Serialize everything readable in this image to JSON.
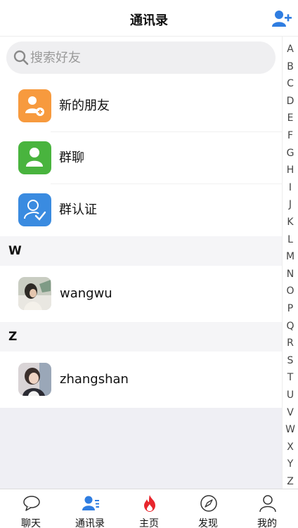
{
  "header": {
    "title": "通讯录",
    "add_icon": "add-friend-icon"
  },
  "search": {
    "placeholder": "搜索好友",
    "icon": "search-icon"
  },
  "menu": [
    {
      "label": "新的朋友",
      "icon": "new-friend-icon",
      "color": "#f79a3e"
    },
    {
      "label": "群聊",
      "icon": "group-chat-icon",
      "color": "#49b43e"
    },
    {
      "label": "群认证",
      "icon": "group-verify-icon",
      "color": "#3a8be0"
    }
  ],
  "sections": [
    {
      "letter": "W",
      "contacts": [
        {
          "name": "wangwu",
          "avatar": "avatar-photo"
        }
      ]
    },
    {
      "letter": "Z",
      "contacts": [
        {
          "name": "zhangshan",
          "avatar": "avatar-photo"
        }
      ]
    }
  ],
  "alphabet": [
    "A",
    "B",
    "C",
    "D",
    "E",
    "F",
    "G",
    "H",
    "I",
    "J",
    "K",
    "L",
    "M",
    "N",
    "O",
    "P",
    "Q",
    "R",
    "S",
    "T",
    "U",
    "V",
    "W",
    "X",
    "Y",
    "Z"
  ],
  "tabs": [
    {
      "label": "聊天",
      "icon": "chat-bubble-icon",
      "active": false
    },
    {
      "label": "通讯录",
      "icon": "contacts-icon",
      "active": true
    },
    {
      "label": "主页",
      "icon": "flame-icon",
      "active": false
    },
    {
      "label": "发现",
      "icon": "compass-icon",
      "active": false
    },
    {
      "label": "我的",
      "icon": "person-icon",
      "active": false
    }
  ],
  "colors": {
    "accent": "#2f7de1",
    "flame": "#e8262d",
    "list_bg": "#efeff4"
  }
}
